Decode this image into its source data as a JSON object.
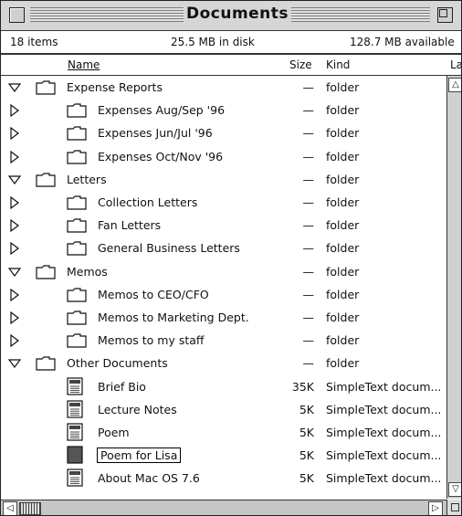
{
  "window": {
    "title": "Documents"
  },
  "info": {
    "items": "18 items",
    "disk": "25.5 MB in disk",
    "available": "128.7 MB available"
  },
  "columns": {
    "name": "Name",
    "size": "Size",
    "kind": "Kind",
    "label": "La"
  },
  "rows": [
    {
      "name": "Expense Reports",
      "size": "—",
      "kind": "folder",
      "type": "folder",
      "level": 0,
      "expanded": true
    },
    {
      "name": "Expenses Aug/Sep '96",
      "size": "—",
      "kind": "folder",
      "type": "folder",
      "level": 1,
      "expanded": false
    },
    {
      "name": "Expenses Jun/Jul '96",
      "size": "—",
      "kind": "folder",
      "type": "folder",
      "level": 1,
      "expanded": false
    },
    {
      "name": "Expenses Oct/Nov '96",
      "size": "—",
      "kind": "folder",
      "type": "folder",
      "level": 1,
      "expanded": false
    },
    {
      "name": "Letters",
      "size": "—",
      "kind": "folder",
      "type": "folder",
      "level": 0,
      "expanded": true
    },
    {
      "name": "Collection Letters",
      "size": "—",
      "kind": "folder",
      "type": "folder",
      "level": 1,
      "expanded": false
    },
    {
      "name": "Fan Letters",
      "size": "—",
      "kind": "folder",
      "type": "folder",
      "level": 1,
      "expanded": false
    },
    {
      "name": "General Business Letters",
      "size": "—",
      "kind": "folder",
      "type": "folder",
      "level": 1,
      "expanded": false
    },
    {
      "name": "Memos",
      "size": "—",
      "kind": "folder",
      "type": "folder",
      "level": 0,
      "expanded": true
    },
    {
      "name": "Memos to CEO/CFO",
      "size": "—",
      "kind": "folder",
      "type": "folder",
      "level": 1,
      "expanded": false
    },
    {
      "name": "Memos to Marketing Dept.",
      "size": "—",
      "kind": "folder",
      "type": "folder",
      "level": 1,
      "expanded": false
    },
    {
      "name": "Memos to my staff",
      "size": "—",
      "kind": "folder",
      "type": "folder",
      "level": 1,
      "expanded": false
    },
    {
      "name": "Other Documents",
      "size": "—",
      "kind": "folder",
      "type": "folder",
      "level": 0,
      "expanded": true
    },
    {
      "name": "Brief Bio",
      "size": "35K",
      "kind": "SimpleText docum...",
      "type": "text-doc",
      "level": 1
    },
    {
      "name": "Lecture Notes",
      "size": "5K",
      "kind": "SimpleText docum...",
      "type": "text-doc",
      "level": 1
    },
    {
      "name": "Poem",
      "size": "5K",
      "kind": "SimpleText docum...",
      "type": "text-doc",
      "level": 1
    },
    {
      "name": "Poem for Lisa",
      "size": "5K",
      "kind": "SimpleText docum...",
      "type": "text-doc",
      "level": 1,
      "selected": true
    },
    {
      "name": "About Mac OS 7.6",
      "size": "5K",
      "kind": "SimpleText docum...",
      "type": "text-doc",
      "level": 1
    }
  ]
}
